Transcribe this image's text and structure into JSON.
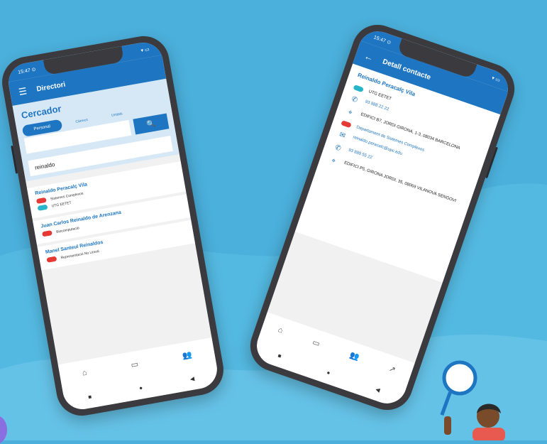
{
  "phone_left": {
    "status": {
      "time": "15:47 ⊙",
      "signal": "▾ ▭"
    },
    "appbar": {
      "menu_icon": "☰",
      "title": "Directori"
    },
    "search": {
      "title": "Cercador",
      "tabs": [
        "Personal",
        "Càrrecs",
        "Unitats"
      ],
      "query": "reinaldo",
      "search_icon": "🔍"
    },
    "results": [
      {
        "name": "Reinaldo Peracalç Vila",
        "lines": [
          {
            "badge": "red",
            "text": "Sistemes Complexos"
          },
          {
            "badge": "teal",
            "text": "UTG EETET"
          }
        ]
      },
      {
        "name": "Juan Carlos Reinaldo de Arenzana",
        "lines": [
          {
            "badge": "red",
            "text": "Biocomputació"
          }
        ]
      },
      {
        "name": "Manel Santeul Reinaldos",
        "lines": [
          {
            "badge": "red",
            "text": "Representació No Lineal"
          }
        ]
      }
    ],
    "bottom_nav": [
      "⌂",
      "▭",
      "👥"
    ],
    "sys_nav": [
      "■",
      "●",
      "◀"
    ]
  },
  "phone_right": {
    "status": {
      "time": "15:47 ⊙",
      "signal": "▾ ▭"
    },
    "appbar": {
      "back_icon": "←",
      "title": "Detall contacte"
    },
    "name": "Reinaldo Peracalç Vila",
    "rows": [
      {
        "icon": "▭",
        "text": "UTG EETET",
        "link": false
      },
      {
        "icon": "✆",
        "text": "93 888 22 22",
        "link": true
      },
      {
        "icon": "⌖",
        "text": "EDIFICI B7, JORDI GIRONA, 1-3, 08034 BARCELONA",
        "link": false
      },
      {
        "icon": "▭",
        "text": "Departament de Sistemes Complexos",
        "link": true
      },
      {
        "icon": "✉",
        "text": "reinaldo.peracalc@upc.edu",
        "link": true
      },
      {
        "icon": "✆",
        "text": "93 888 55 22",
        "link": true
      },
      {
        "icon": "⌖",
        "text": "EDIFICI P5, GIRONA JORDI, 35, 08069 VILANOVA SENGOVI",
        "link": false
      }
    ],
    "bottom_nav": [
      "⌂",
      "▭",
      "👥",
      "↗"
    ],
    "sys_nav": [
      "■",
      "●",
      "◀"
    ]
  },
  "colors": {
    "background": "#4bb0dc",
    "accent": "#1e76c2",
    "badge_red": "#e53935",
    "badge_teal": "#26b5c9"
  }
}
